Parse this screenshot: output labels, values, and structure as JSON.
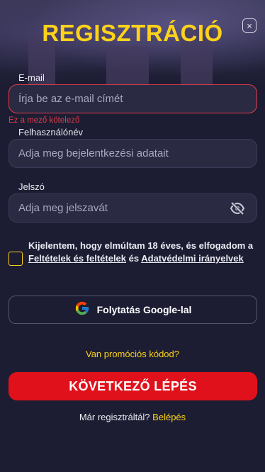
{
  "header": {
    "title": "REGISZTRÁCIÓ",
    "close_label": "×"
  },
  "form": {
    "email": {
      "label": "E-mail",
      "value": "",
      "placeholder": "Írja be az e-mail címét",
      "error": "Ez a mező kötelező"
    },
    "username": {
      "label": "Felhasználónév",
      "value": "",
      "placeholder": "Adja meg bejelentkezési adatait"
    },
    "password": {
      "label": "Jelszó",
      "value": "",
      "placeholder": "Adja meg jelszavát",
      "toggle_icon": "eye-off-icon"
    }
  },
  "consent": {
    "checked": false,
    "text_before": "Kijelentem, hogy elmúltam 18 éves, és elfogadom a ",
    "terms_link": "Feltételek és feltételek",
    "text_middle": " és ",
    "privacy_link": "Adatvédelmi irányelvek"
  },
  "google": {
    "label": "Folytatás Google-lal",
    "icon": "google-icon"
  },
  "promo": {
    "label": "Van promóciós kódod?"
  },
  "next_button": {
    "label": "KÖVETKEZŐ LÉPÉS"
  },
  "footer": {
    "question": "Már regisztráltál?",
    "login_link": "Belépés"
  },
  "colors": {
    "background": "#1c1d32",
    "accent_yellow": "#ffd21a",
    "primary_red": "#e0111b",
    "error_red": "#e23b4a",
    "field_bg": "#2a2b43"
  }
}
